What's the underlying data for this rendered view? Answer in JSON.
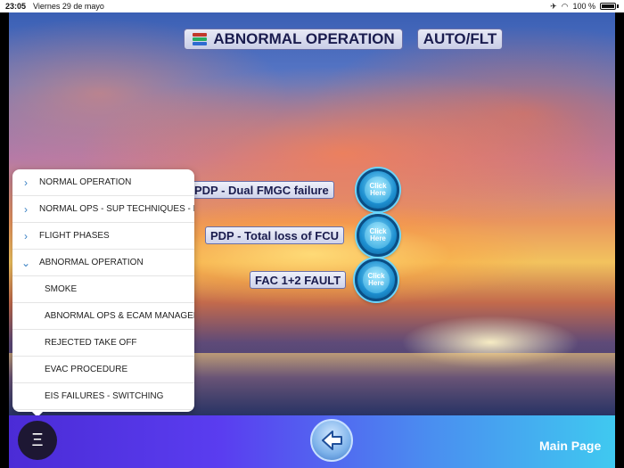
{
  "status_bar": {
    "time": "23:05",
    "date": "Viernes 29 de mayo",
    "battery": "100 %"
  },
  "header": {
    "title": "ABNORMAL OPERATION",
    "mode": "AUTO/FLT",
    "title_icon": "book-stack-icon"
  },
  "procedures": [
    {
      "label": "PDP - Dual FMGC failure",
      "button_label": "Click Here"
    },
    {
      "label": "PDP - Total loss of FCU",
      "button_label": "Click Here"
    },
    {
      "label": "FAC 1+2 FAULT",
      "button_label": "Click Here"
    }
  ],
  "menu": {
    "items": [
      {
        "label": "NORMAL OPERATION",
        "icon": "chevron-right-icon",
        "level": "top"
      },
      {
        "label": "NORMAL OPS - SUP TECHNIQUES - P",
        "icon": "chevron-right-icon",
        "level": "top"
      },
      {
        "label": "FLIGHT PHASES",
        "icon": "chevron-right-icon",
        "level": "top"
      },
      {
        "label": "ABNORMAL OPERATION",
        "icon": "chevron-down-icon",
        "level": "top"
      },
      {
        "label": "SMOKE",
        "level": "sub"
      },
      {
        "label": "ABNORMAL OPS & ECAM MANAGEME",
        "level": "sub"
      },
      {
        "label": "REJECTED TAKE OFF",
        "level": "sub"
      },
      {
        "label": "EVAC PROCEDURE",
        "level": "sub"
      },
      {
        "label": "EIS FAILURES - SWITCHING",
        "level": "sub"
      }
    ]
  },
  "bottom_bar": {
    "menu_glyph": "Ξ",
    "main_page_label": "Main Page"
  },
  "colors": {
    "accent": "#3b82c4",
    "pill_text": "#1a1c4e",
    "button_blue": "#1d8fd0"
  }
}
